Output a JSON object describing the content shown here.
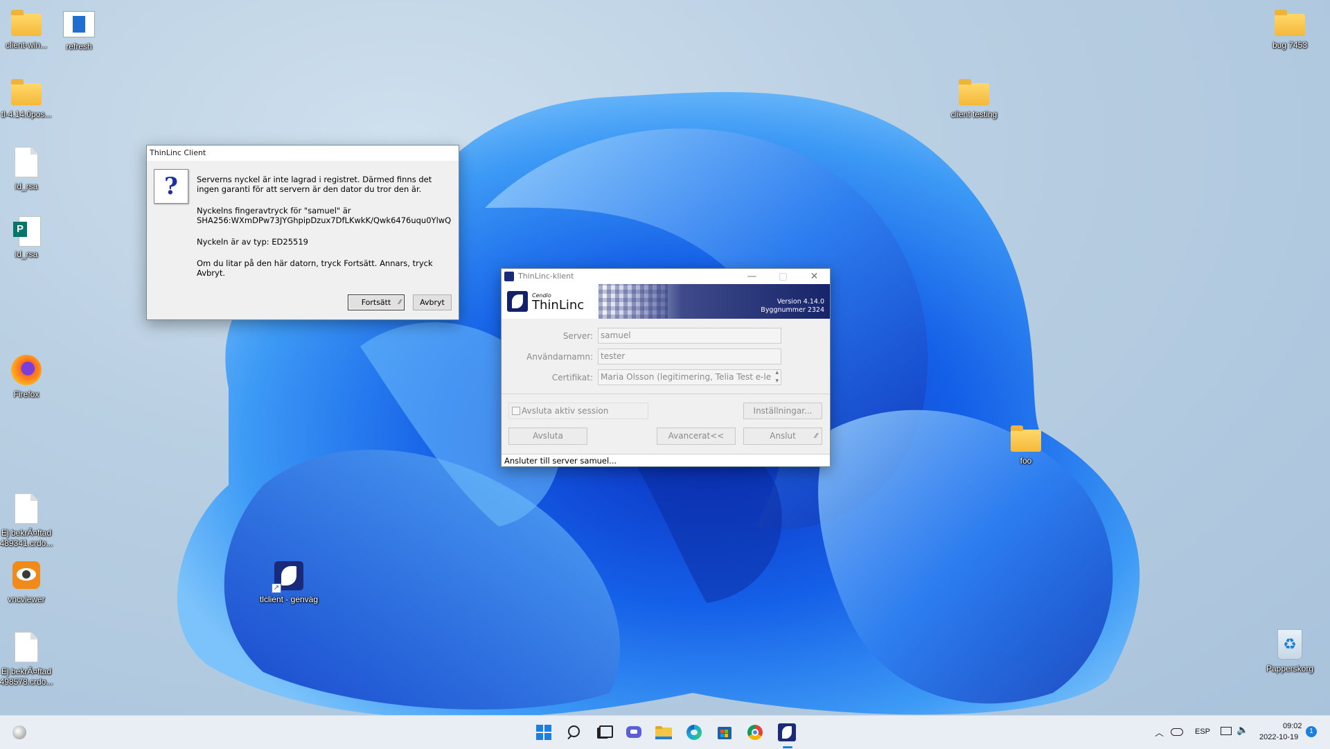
{
  "desktop": {
    "icons": [
      {
        "label": "client-win..."
      },
      {
        "label": "refresh"
      },
      {
        "label": "tl-4.14.0pos..."
      },
      {
        "label": "id_rsa"
      },
      {
        "label": "id_rsa"
      },
      {
        "label": "Firefox"
      },
      {
        "label": "Ej bekrÃ¤ftad 489341.crdo..."
      },
      {
        "label": "vncviewer"
      },
      {
        "label": "Ej bekrÃ¤ftad 498578.crdo..."
      },
      {
        "label": "tlclient - genväg"
      },
      {
        "label": "bug 7453"
      },
      {
        "label": "client testing"
      },
      {
        "label": "foo"
      },
      {
        "label": "Papperskorg"
      }
    ]
  },
  "trust_dialog": {
    "title": "ThinLinc Client",
    "message_1": "Serverns nyckel är inte lagrad i registret. Därmed finns det ingen garanti för att servern är den dator du tror den är.",
    "fingerprint_label": "Nyckelns fingeravtryck för \"samuel\" är",
    "fingerprint_value": "SHA256:WXmDPw73JYGhpipDzux7DfLKwkK/Qwk6476uqu0YlwQ",
    "key_type": "Nyckeln är av typ: ED25519",
    "instruction": "Om du litar på den här datorn, tryck Fortsätt. Annars, tryck Avbryt.",
    "continue_label": "Fortsätt",
    "cancel_label": "Avbryt"
  },
  "tl_client": {
    "title": "ThinLinc-klient",
    "brand_small": "Cendio",
    "brand": "ThinLinc",
    "version": "Version 4.14.0",
    "build": "Byggnummer 2324",
    "server_label": "Server:",
    "server_value": "samuel",
    "username_label": "Användarnamn:",
    "username_value": "tester",
    "cert_label": "Certifikat:",
    "cert_value": "Maria Olsson (legitimering, Telia Test e-le",
    "end_session_label": "Avsluta aktiv session",
    "settings_label": "Inställningar...",
    "quit_label": "Avsluta",
    "advanced_label": "Avancerat<<",
    "connect_label": "Anslut",
    "status": "Ansluter till server samuel..."
  },
  "taskbar": {
    "language": "ESP",
    "time": "09:02",
    "date": "2022-10-19",
    "notification_count": "1",
    "pinned": [
      "start-icon",
      "search-icon",
      "task-view-icon",
      "chat-icon",
      "file-explorer-icon",
      "edge-icon",
      "store-icon",
      "chrome-icon",
      "thinlinc-icon"
    ]
  }
}
